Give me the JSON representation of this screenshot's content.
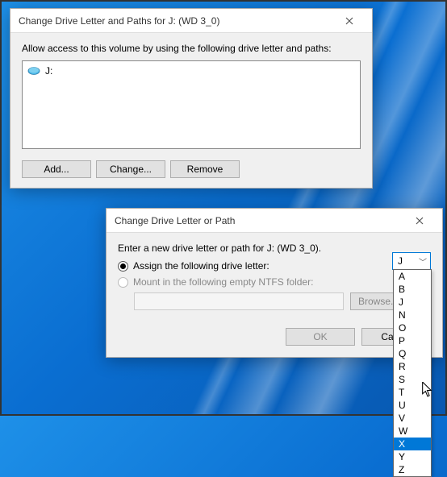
{
  "dialog1": {
    "title": "Change Drive Letter and Paths for J: (WD 3_0)",
    "instruction": "Allow access to this volume by using the following drive letter and paths:",
    "drive_label": "J:",
    "icon_name": "drive-icon",
    "buttons": {
      "add": "Add...",
      "change": "Change...",
      "remove": "Remove"
    }
  },
  "dialog2": {
    "title": "Change Drive Letter or Path",
    "instruction": "Enter a new drive letter or path for J: (WD 3_0).",
    "radio_assign": "Assign the following drive letter:",
    "radio_mount": "Mount in the following empty NTFS folder:",
    "browse": "Browse...",
    "ok": "OK",
    "cancel": "Cancel",
    "selected_letter": "J",
    "drive_letters": [
      "A",
      "B",
      "J",
      "N",
      "O",
      "P",
      "Q",
      "R",
      "S",
      "T",
      "U",
      "V",
      "W",
      "X",
      "Y",
      "Z"
    ],
    "hover_letter": "X"
  }
}
